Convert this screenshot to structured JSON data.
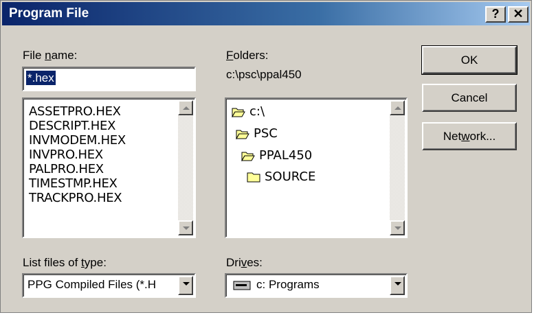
{
  "window": {
    "title": "Program File",
    "help_label": "?",
    "close_label": "✕"
  },
  "file_name": {
    "label_pre": "File ",
    "label_key": "n",
    "label_post": "ame:",
    "value": "*.hex",
    "files": [
      "ASSETPRO.HEX",
      "DESCRIPT.HEX",
      "INVMODEM.HEX",
      "INVPRO.HEX",
      "PALPRO.HEX",
      "TIMESTMP.HEX",
      "TRACKPRO.HEX"
    ]
  },
  "folders": {
    "label_key": "F",
    "label_post": "olders:",
    "current_path": "c:\\psc\\ppal450",
    "tree": [
      "c:\\",
      "PSC",
      "PPAL450",
      "SOURCE"
    ]
  },
  "buttons": {
    "ok": "OK",
    "cancel": "Cancel",
    "network_pre": "Net",
    "network_key": "w",
    "network_post": "ork..."
  },
  "file_type": {
    "label_pre": "List files of ",
    "label_key": "t",
    "label_post": "ype:",
    "selected": "PPG Compiled Files (*.H"
  },
  "drives": {
    "label_pre": "Dri",
    "label_key": "v",
    "label_post": "es:",
    "selected": "c: Programs"
  },
  "colors": {
    "title_bar": "#0a246a",
    "face": "#d4d0c8",
    "selection": "#0a246a",
    "folder_fill": "#ffff99"
  },
  "icons": {
    "folder_open": "folder-open-icon",
    "folder_closed": "folder-closed-icon",
    "drive": "drive-icon"
  }
}
